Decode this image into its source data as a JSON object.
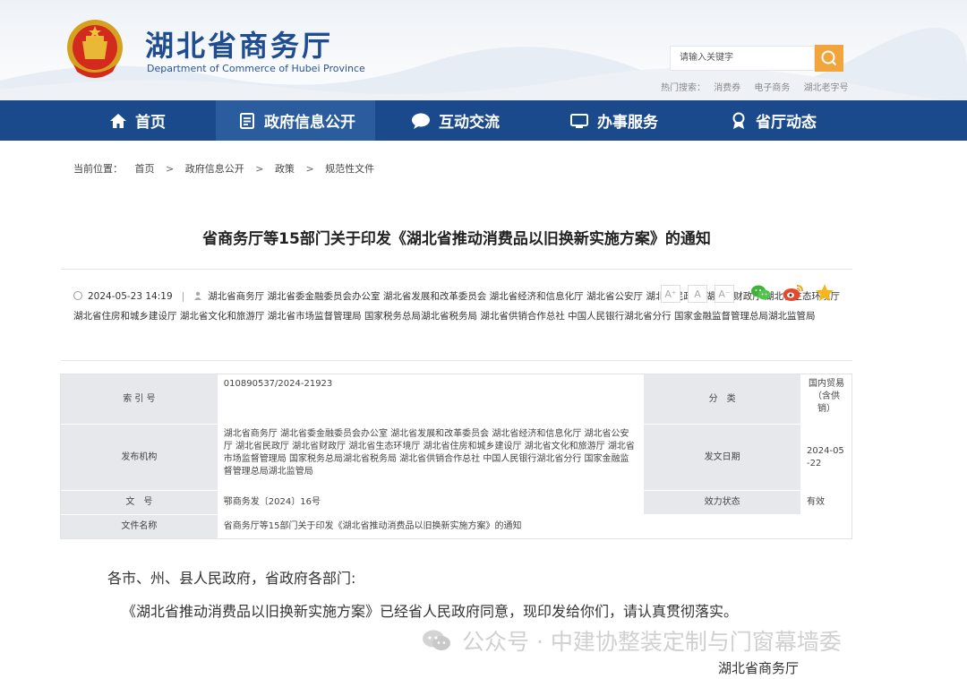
{
  "site": {
    "title_cn": "湖北省商务厅",
    "title_en": "Department of Commerce of Hubei Province"
  },
  "search": {
    "placeholder": "请输入关键字",
    "hot_label": "热门搜索：",
    "hot_terms": [
      "消费券",
      "电子商务",
      "湖北老字号"
    ]
  },
  "nav": {
    "items": [
      {
        "label": "首页",
        "icon": "home-icon"
      },
      {
        "label": "政府信息公开",
        "icon": "document-icon"
      },
      {
        "label": "互动交流",
        "icon": "chat-bubble-icon"
      },
      {
        "label": "办事服务",
        "icon": "monitor-icon"
      },
      {
        "label": "省厅动态",
        "icon": "medal-icon"
      }
    ],
    "active": "政府信息公开"
  },
  "breadcrumb": {
    "label": "当前位置：",
    "items": [
      "首页",
      "政府信息公开",
      "政策",
      "规范性文件"
    ]
  },
  "article": {
    "title": "省商务厅等15部门关于印发《湖北省推动消费品以旧换新实施方案》的通知",
    "datetime": "2024-05-23 14:19",
    "publishers": "湖北省商务厅 湖北省委金融委员会办公室 湖北省发展和改革委员会 湖北省经济和信息化厅 湖北省公安厅 湖北省民政厅 湖北省财政厅 湖北省生态环境厅 湖北省住房和城乡建设厅 湖北省文化和旅游厅 湖北省市场监督管理局 国家税务总局湖北省税务局 湖北省供销合作总社 中国人民银行湖北省分行 国家金融监督管理总局湖北监管局",
    "font_buttons": [
      "A⁺",
      "A",
      "A⁻"
    ],
    "share_icons": [
      "wechat-icon",
      "weibo-icon",
      "favorite-star-icon"
    ]
  },
  "info_table": {
    "index_label": "索 引 号",
    "index_value": "010890537/2024-21923",
    "category_label": "分　类",
    "category_value": "国内贸易（含供销）",
    "issuer_label": "发布机构",
    "issuer_value": "湖北省商务厅 湖北省委金融委员会办公室 湖北省发展和改革委员会 湖北省经济和信息化厅 湖北省公安厅 湖北省民政厅 湖北省财政厅 湖北省生态环境厅 湖北省住房和城乡建设厅 湖北省文化和旅游厅 湖北省市场监督管理局 国家税务总局湖北省税务局 湖北省供销合作总社 中国人民银行湖北省分行 国家金融监督管理总局湖北监管局",
    "date_label": "发文日期",
    "date_value": "2024-05-22",
    "docno_label": "文　号",
    "docno_value": "鄂商务发〔2024〕16号",
    "status_label": "效力状态",
    "status_value": "有效",
    "filename_label": "文件名称",
    "filename_value": "省商务厅等15部门关于印发《湖北省推动消费品以旧换新实施方案》的通知"
  },
  "content": {
    "salutation": "各市、州、县人民政府，省政府各部门:",
    "paragraph": "《湖北省推动消费品以旧换新实施方案》已经省人民政府同意，现印发给你们，请认真贯彻落实。",
    "signer": "湖北省商务厅"
  },
  "watermark": {
    "text": "公众号 · 中建协整装定制与门窗幕墙委"
  },
  "colors": {
    "nav_bg": "#1b4a8c",
    "nav_active": "#2b5d9e",
    "title_blue": "#1f4d8f",
    "search_btn": "#f2a53c",
    "label_bg": "#e6e8ec"
  }
}
